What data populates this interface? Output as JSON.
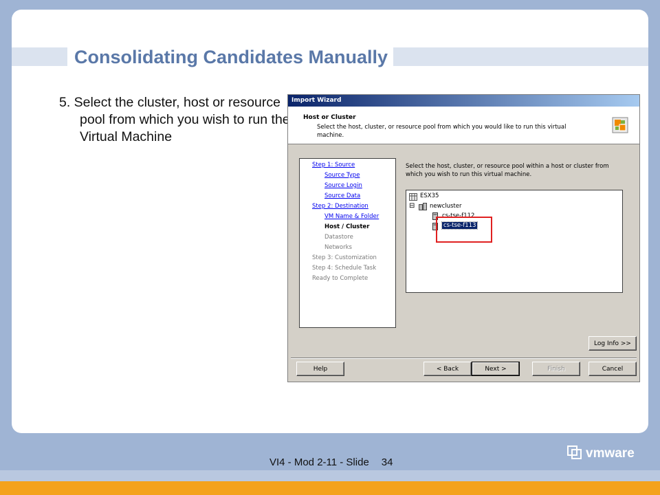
{
  "slide": {
    "title": "Consolidating Candidates Manually",
    "bullet": "5. Select the cluster, host or resource pool from which you wish to run the Virtual Machine",
    "footer_label": "VI4 - Mod 2-11 - Slide",
    "footer_page": "34",
    "logo_text": "vmware"
  },
  "wizard": {
    "window_title": "Import Wizard",
    "header_title": "Host or Cluster",
    "header_desc": "Select the host, cluster, or resource pool from which you would like to run this virtual machine.",
    "instruction": "Select the host, cluster, or resource pool within a host or cluster from which you wish to run this virtual machine.",
    "steps": [
      {
        "label": "Step 1: Source",
        "state": "link"
      },
      {
        "label": "Source Type",
        "state": "link"
      },
      {
        "label": "Source Login",
        "state": "link"
      },
      {
        "label": "Source Data",
        "state": "link"
      },
      {
        "label": "Step 2: Destination",
        "state": "link"
      },
      {
        "label": "VM Name & Folder",
        "state": "link"
      },
      {
        "label": "Host / Cluster",
        "state": "current"
      },
      {
        "label": "Datastore",
        "state": "disabled"
      },
      {
        "label": "Networks",
        "state": "disabled"
      },
      {
        "label": "Step 3: Customization",
        "state": "disabled"
      },
      {
        "label": "Step 4: Schedule Task",
        "state": "disabled"
      },
      {
        "label": "Ready to Complete",
        "state": "disabled"
      }
    ],
    "tree": {
      "root": "ESX35",
      "cluster": "newcluster",
      "host1": "cs-tse-f112",
      "host2": "cs-tse-f113",
      "expand_symbol": "⊟"
    },
    "buttons": {
      "log_info": "Log Info >>",
      "help": "Help",
      "back": "< Back",
      "next": "Next >",
      "finish": "Finish",
      "cancel": "Cancel"
    }
  }
}
